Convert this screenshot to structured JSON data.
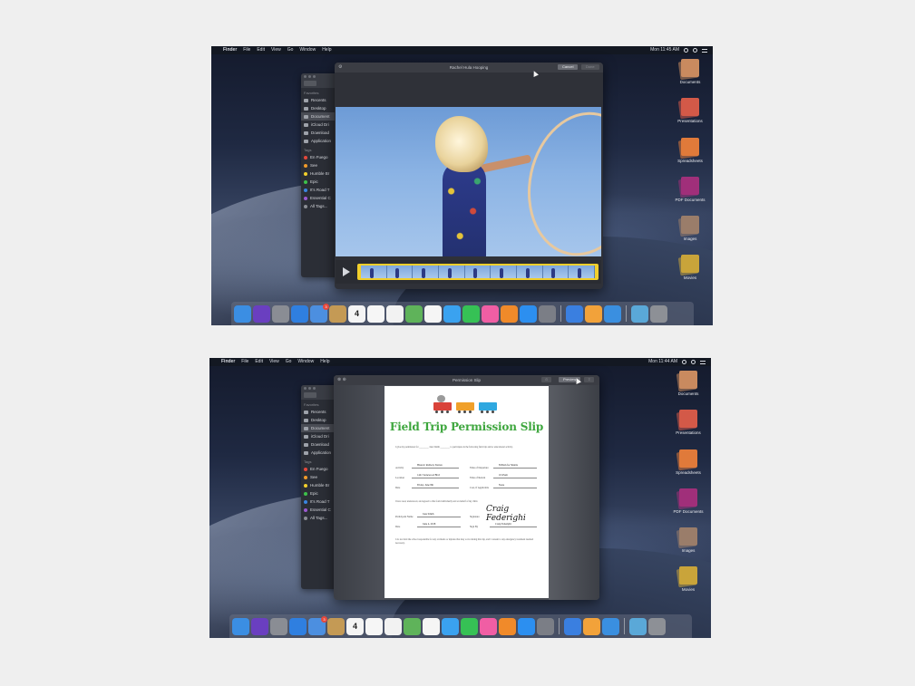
{
  "menubar": {
    "app": "Finder",
    "menus": [
      "File",
      "Edit",
      "View",
      "Go",
      "Window",
      "Help"
    ],
    "clock_top": "Mon 11:45 AM",
    "clock_bottom": "Mon 11:44 AM"
  },
  "finder": {
    "favorites_header": "Favorites",
    "favorites": [
      "Recents",
      "Desktop",
      "Document",
      "iCloud Dri",
      "Download",
      "Application"
    ],
    "tags_header": "Tags",
    "tags": [
      {
        "label": "En Fuego",
        "color": "#e5483c"
      },
      {
        "label": "See",
        "color": "#f09a2a"
      },
      {
        "label": "Humble Br",
        "color": "#f2cf2b"
      },
      {
        "label": "Epic",
        "color": "#3dc14b"
      },
      {
        "label": "It's Road T",
        "color": "#3a84e0"
      },
      {
        "label": "Essential C",
        "color": "#9b59d0"
      },
      {
        "label": "All Tags...",
        "color": "#8a8d94"
      }
    ]
  },
  "video_window": {
    "title": "Rachel Hula Hooping",
    "cancel": "Cancel",
    "done": "Done"
  },
  "doc_window": {
    "title": "Permission Slip",
    "open_with": "Preview"
  },
  "document": {
    "title": "Field Trip Permission Slip",
    "intro": "I give my permission for ________ Jane Smith ________ to participate in the following field trip and/or educational activity.",
    "rows": [
      {
        "l1": "Activity",
        "v1": "Historic Railway Station",
        "l2": "Time of Departure",
        "v2": "8:00am for Shuttle"
      },
      {
        "l1": "Location",
        "v1": "1441 Stonewood Blvd",
        "l2": "Time of Return",
        "v2": "10:45am"
      },
      {
        "l1": "Date",
        "v1": "Friday, June 8th",
        "l2": "Cost, if Applicable",
        "v2": "None"
      }
    ],
    "consent": "I have read, understood, and agreed to this form individually and on behalf of my child.",
    "sign_rows": [
      {
        "l1": "Participant Name",
        "v1": "Jane Smith",
        "l2": "Signature",
        "v2": ""
      },
      {
        "l1": "Date",
        "v1": "June 4, 2018",
        "l2": "Sign By",
        "v2": "Craig Federighi"
      }
    ],
    "signature": "Craig Federighi",
    "footer": "I do not hold the school responsible for any accidents or injuries that may occur during this trip, and I consent to any emergency treatment deemed necessary."
  },
  "desktop_stacks": [
    {
      "label": "Documents",
      "color": "#c98b5f"
    },
    {
      "label": "Presentations",
      "color": "#d35a48"
    },
    {
      "label": "Spreadsheets",
      "color": "#e07a3a"
    },
    {
      "label": "PDF Documents",
      "color": "#a0307a"
    },
    {
      "label": "Images",
      "color": "#9a7d6a"
    },
    {
      "label": "Movies",
      "color": "#c9a43a"
    }
  ],
  "dock": {
    "calendar_day": "4",
    "icons": [
      {
        "name": "finder-icon",
        "color": "#3b8ee3"
      },
      {
        "name": "siri-icon",
        "color": "#6a3fc0"
      },
      {
        "name": "launchpad-icon",
        "color": "#8a8d94"
      },
      {
        "name": "safari-icon",
        "color": "#2f7fe0"
      },
      {
        "name": "mail-icon",
        "color": "#4c8fe0"
      },
      {
        "name": "notes-icon",
        "color": "#c49a55"
      },
      {
        "name": "calendar-icon",
        "color": "#f4f4f4"
      },
      {
        "name": "reminders-icon",
        "color": "#f6f6f6"
      },
      {
        "name": "stickies-icon",
        "color": "#f2f2f2"
      },
      {
        "name": "maps-icon",
        "color": "#5fb35a"
      },
      {
        "name": "photos-icon",
        "color": "#f5f5f5"
      },
      {
        "name": "messages-icon",
        "color": "#3aa2f0"
      },
      {
        "name": "facetime-icon",
        "color": "#36c155"
      },
      {
        "name": "itunes-icon",
        "color": "#f05ea4"
      },
      {
        "name": "books-icon",
        "color": "#f08a2a"
      },
      {
        "name": "app-store-icon",
        "color": "#2c8ff0"
      },
      {
        "name": "system-preferences-icon",
        "color": "#7b7e86"
      },
      {
        "name": "keynote-icon",
        "color": "#3a7fe0"
      },
      {
        "name": "pages-icon",
        "color": "#f2a23a"
      },
      {
        "name": "xcode-icon",
        "color": "#3a8fe0"
      }
    ],
    "badge_count": "3"
  }
}
